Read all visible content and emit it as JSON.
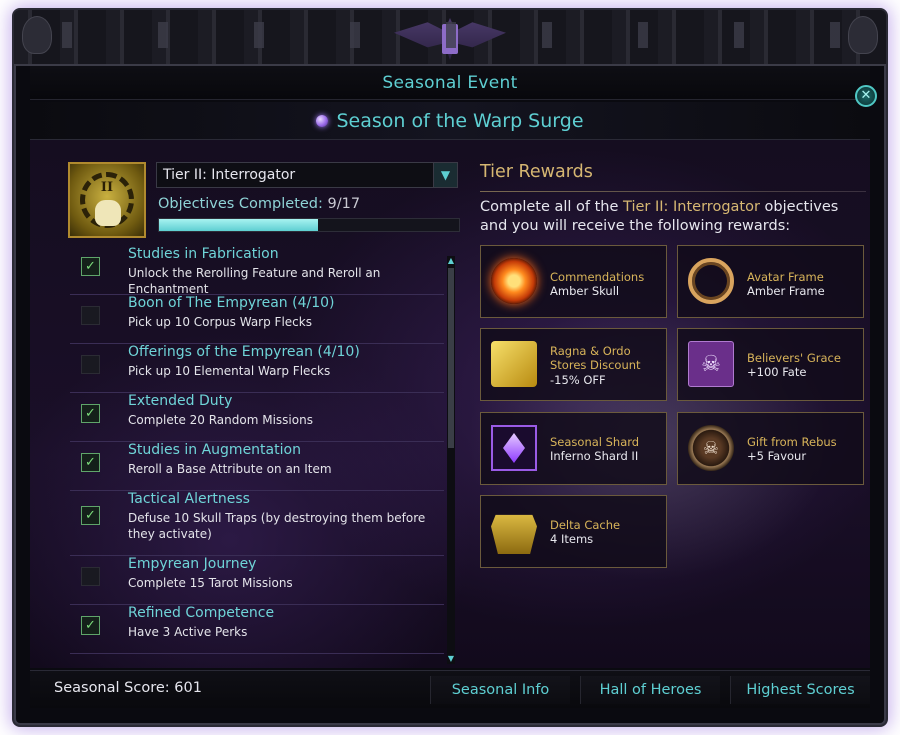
{
  "window": {
    "title": "Seasonal Event",
    "close_icon": "close-icon",
    "subtitle": "Season of the Warp Surge"
  },
  "tier": {
    "numeral": "II",
    "selected": "Tier II: Interrogator",
    "objectives_label": "Objectives Completed:",
    "objectives_count": "9/17",
    "progress_fraction": 0.53
  },
  "objectives": [
    {
      "title": "Studies in Fabrication",
      "desc": "Unlock the Rerolling Feature and Reroll an Enchantment",
      "completed": true
    },
    {
      "title": "Boon of The Empyrean (4/10)",
      "desc": "Pick up 10 Corpus Warp Flecks",
      "completed": false
    },
    {
      "title": "Offerings of the Empyrean (4/10)",
      "desc": "Pick up 10 Elemental Warp Flecks",
      "completed": false
    },
    {
      "title": "Extended Duty",
      "desc": "Complete 20 Random Missions",
      "completed": true
    },
    {
      "title": "Studies in Augmentation",
      "desc": "Reroll a Base Attribute on an Item",
      "completed": true
    },
    {
      "title": "Tactical Alertness",
      "desc": "Defuse 10 Skull Traps (by destroying them before they activate)",
      "completed": true
    },
    {
      "title": "Empyrean Journey",
      "desc": "Complete 15 Tarot Missions",
      "completed": false
    },
    {
      "title": "Refined Competence",
      "desc": "Have 3 Active Perks",
      "completed": true
    }
  ],
  "rewards": {
    "title": "Tier Rewards",
    "intro_before": "Complete all of the ",
    "intro_tier": "Tier II: Interrogator",
    "intro_after": " objectives and you will receive the following rewards:",
    "items": [
      {
        "name": "Commendations",
        "value": "Amber Skull",
        "icon": "commendations-icon"
      },
      {
        "name": "Avatar Frame",
        "value": "Amber Frame",
        "icon": "avatar-frame-icon"
      },
      {
        "name": "Ragna & Ordo Stores Discount",
        "value": "-15% OFF",
        "icon": "coins-icon"
      },
      {
        "name": "Believers' Grace",
        "value": "+100 Fate",
        "icon": "skull-icon"
      },
      {
        "name": "Seasonal Shard",
        "value": "Inferno Shard II",
        "icon": "shard-icon"
      },
      {
        "name": "Gift from Rebus",
        "value": "+5 Favour",
        "icon": "seal-icon"
      },
      {
        "name": "Delta Cache",
        "value": "4 Items",
        "icon": "chest-icon"
      }
    ]
  },
  "footer": {
    "score_label": "Seasonal Score: 601",
    "buttons": [
      "Seasonal Info",
      "Hall of Heroes",
      "Highest Scores"
    ]
  },
  "colors": {
    "accent_cyan": "#5ecfd2",
    "gold": "#d6b772",
    "check_green": "#7bdc7b"
  }
}
